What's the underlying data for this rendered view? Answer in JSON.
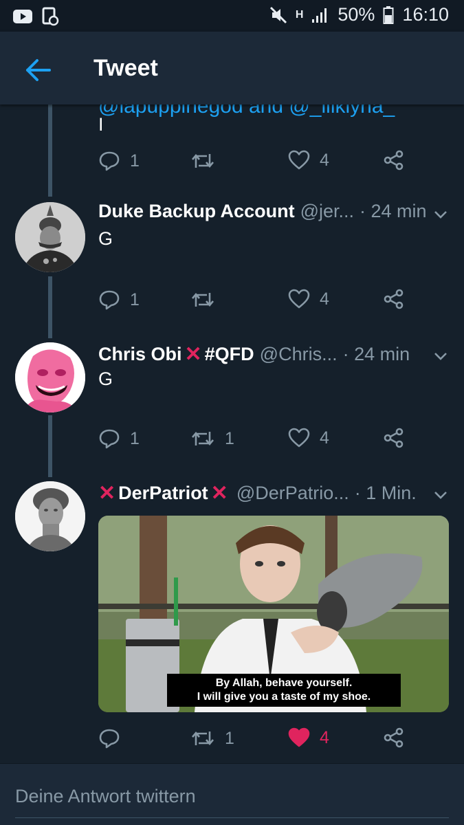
{
  "status_bar": {
    "network": "H",
    "battery": "50%",
    "clock": "16:10"
  },
  "header": {
    "title": "Tweet"
  },
  "tweets": [
    {
      "mentions_cutoff": "@lapuppinegod and @_lilkiyna_",
      "text": "I",
      "replies": "1",
      "retweets": "",
      "likes": "4"
    },
    {
      "name": "Duke Backup Account",
      "handle": "@jer...",
      "time": "· 24 min",
      "text": "G",
      "replies": "1",
      "retweets": "",
      "likes": "4"
    },
    {
      "name": "Chris Obi",
      "name_suffix": "#QFD",
      "handle": "@Chris...",
      "time": "· 24 min",
      "text": "G",
      "replies": "1",
      "retweets": "1",
      "likes": "4"
    },
    {
      "name": "DerPatriot",
      "handle": "@DerPatrio...",
      "time": "· 1 Min.",
      "media_caption_line1": "By Allah, behave yourself.",
      "media_caption_line2": "I will give you a taste of my shoe.",
      "replies": "",
      "retweets": "1",
      "likes": "4",
      "liked": true
    }
  ],
  "reply_bar": {
    "placeholder": "Deine Antwort twittern"
  },
  "colors": {
    "background": "#15202b",
    "header": "#1c2938",
    "accent": "#1da1f2",
    "like": "#e0245e",
    "muted": "#8899a6"
  }
}
